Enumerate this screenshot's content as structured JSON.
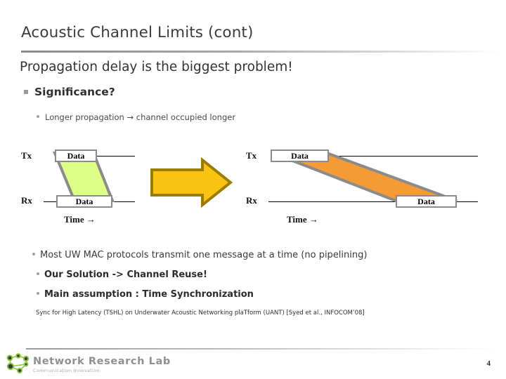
{
  "slide": {
    "title": "Acoustic Channel Limits (cont)",
    "lead": "Propagation delay is the biggest problem!",
    "bullet_l1": "Significance?",
    "bullet_l2": "Longer propagation → channel occupied longer",
    "bottom_bullets": [
      "Most UW MAC protocols transmit one message at a time (no pipelining)",
      "Our Solution -> Channel Reuse!",
      "Main assumption : Time Synchronization"
    ],
    "citation": "Sync for High Latency (TSHL) on Underwater Acoustic Networking plaTform (UANT) [Syed et al., INFOCOM’08]",
    "page_number": "4"
  },
  "diagram_left": {
    "tx_label": "Tx",
    "rx_label": "Rx",
    "tx_box_label": "Data",
    "rx_box_label": "Data",
    "time_label": "Time →",
    "fill_color": "#ddff88",
    "stroke_color": "#8b8b8b"
  },
  "diagram_right": {
    "tx_label": "Tx",
    "rx_label": "Rx",
    "tx_box_label": "Data",
    "rx_box_label": "Data",
    "time_label": "Time →",
    "fill_color": "#f59b36",
    "stroke_color": "#8b8b8b"
  },
  "arrow": {
    "name": "right-arrow",
    "fill_color": "#fbc311",
    "stroke_color": "#9a7c06"
  },
  "footer": {
    "lab_name": "Network Research Lab",
    "tagline": "Communication Innovation",
    "logo_color": "#8cc63e"
  },
  "colors": {
    "title_text": "#3b3b3b",
    "body_text": "#3a3a3a",
    "rule": "#9b9b9b"
  }
}
